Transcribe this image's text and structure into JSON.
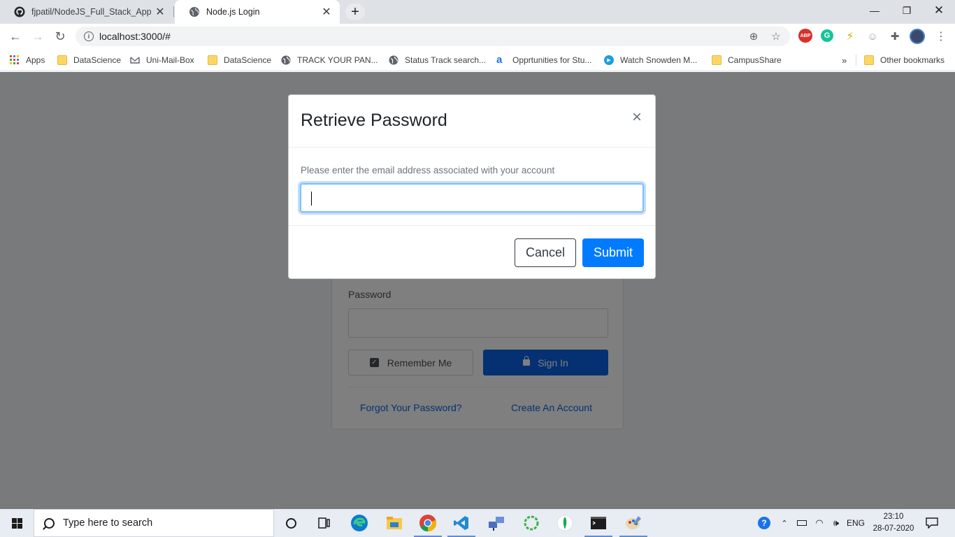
{
  "browser": {
    "tabs": [
      {
        "title": "fjpatil/NodeJS_Full_Stack_App",
        "icon": "github-icon",
        "active": false
      },
      {
        "title": "Node.js Login",
        "icon": "globe-icon",
        "active": true
      }
    ],
    "url": "localhost:3000/#",
    "bookmarks": [
      {
        "label": "Apps",
        "icon": "apps-grid-icon"
      },
      {
        "label": "DataScience",
        "icon": "folder-icon"
      },
      {
        "label": "Uni-Mail-Box",
        "icon": "mail-icon"
      },
      {
        "label": "DataScience",
        "icon": "folder-icon"
      },
      {
        "label": "TRACK YOUR PAN...",
        "icon": "globe-icon"
      },
      {
        "label": "Status Track search...",
        "icon": "globe-icon"
      },
      {
        "label": "Opprtunities for Stu...",
        "icon": "letter-a-icon"
      },
      {
        "label": "Watch Snowden M...",
        "icon": "play-icon"
      },
      {
        "label": "CampusShare",
        "icon": "folder-icon"
      }
    ],
    "overflow_label": "»",
    "other_bookmarks": "Other bookmarks",
    "extensions": [
      {
        "label": "ABP",
        "color": "#d9302c"
      },
      {
        "label": "G",
        "color": "#15c39a"
      }
    ]
  },
  "login": {
    "password_label": "Password",
    "remember_label": "Remember Me",
    "signin_label": "Sign In",
    "forgot_link": "Forgot Your Password?",
    "create_link": "Create An Account"
  },
  "modal": {
    "title": "Retrieve Password",
    "close": "×",
    "prompt": "Please enter the email address associated with your account",
    "email_value": "",
    "cancel_label": "Cancel",
    "submit_label": "Submit"
  },
  "taskbar": {
    "search_placeholder": "Type here to search",
    "language": "ENG",
    "time": "23:10",
    "date": "28-07-2020"
  },
  "colors": {
    "primary": "#007bff",
    "signin": "#0b63e5",
    "overlay": "rgba(0,0,0,0.5)"
  }
}
